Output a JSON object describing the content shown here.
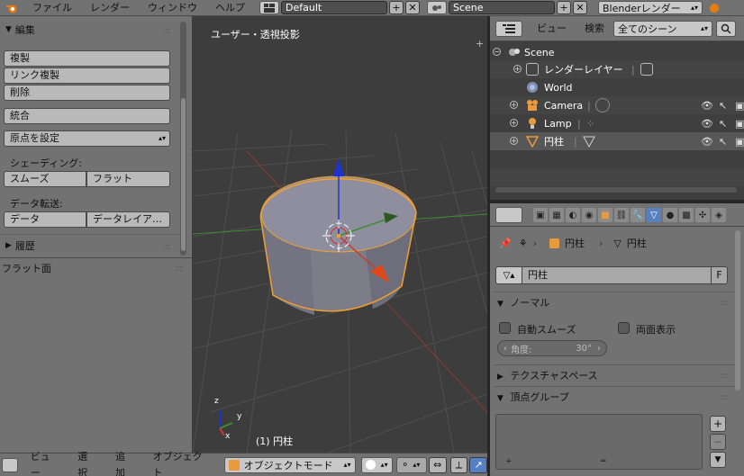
{
  "topbar": {
    "menus": [
      "ファイル",
      "レンダー",
      "ウィンドウ",
      "ヘルプ"
    ],
    "screen_layout": "Default",
    "scene": "Scene",
    "render_engine": "Blenderレンダー"
  },
  "toolpanel": {
    "edit_header": "編集",
    "duplicate": "複製",
    "duplicate_linked": "リンク複製",
    "delete": "削除",
    "join": "統合",
    "set_origin": "原点を設定",
    "shading_label": "シェーディング:",
    "smooth": "スムーズ",
    "flat": "フラット",
    "data_transfer_label": "データ転送:",
    "data": "データ",
    "data_layout": "データレイア…",
    "history_header": "履歴",
    "last_operator": "フラット面"
  },
  "viewport": {
    "view_name": "ユーザー・透視投影",
    "object_label": "(1) 円柱",
    "axis_x": "x",
    "axis_y": "y",
    "axis_z": "z"
  },
  "bottombar": {
    "menus": [
      "ビュー",
      "選択",
      "追加",
      "オブジェクト"
    ],
    "mode": "オブジェクトモード"
  },
  "outliner": {
    "view_menu": "ビュー",
    "search_menu": "検索",
    "display_mode": "全てのシーン",
    "items": [
      {
        "label": "Scene"
      },
      {
        "label": "レンダーレイヤー"
      },
      {
        "label": "World"
      },
      {
        "label": "Camera"
      },
      {
        "label": "Lamp"
      },
      {
        "label": "円柱"
      }
    ]
  },
  "properties": {
    "breadcrumb_object": "円柱",
    "breadcrumb_data": "円柱",
    "mesh_name": "円柱",
    "fake_user": "F",
    "normals_header": "ノーマル",
    "auto_smooth": "自動スムーズ",
    "double_sided": "両面表示",
    "angle_label": "角度:",
    "angle_value": "30°",
    "texture_space_header": "テクスチャスペース",
    "vertex_groups_header": "頂点グループ",
    "add_button": "+",
    "remove_button": "−",
    "more_button": "▼"
  },
  "colors": {
    "header_bg": "#727272",
    "viewport_bg": "#3d3d3d",
    "selection_outline": "#f0a030",
    "axis_x": "#c83c28",
    "axis_y": "#3c8c32",
    "axis_z": "#1e32d2"
  }
}
